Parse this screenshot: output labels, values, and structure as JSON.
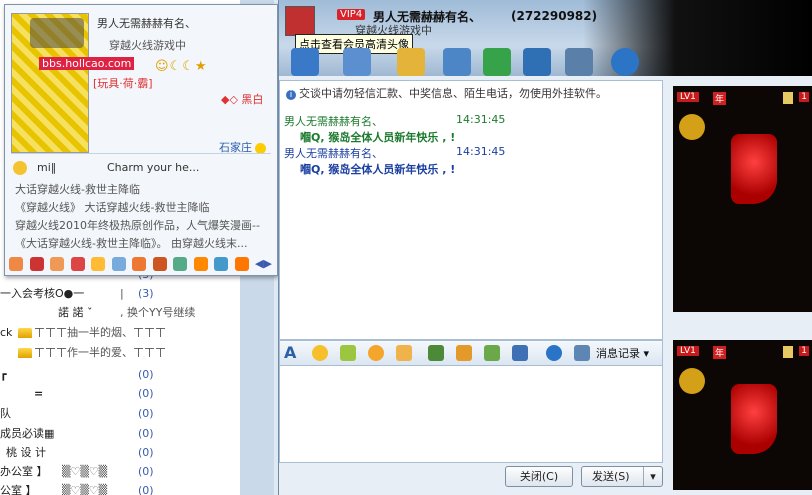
{
  "contacts": {
    "rows": [
      {
        "name": "",
        "extra": "",
        "count": "(3)"
      },
      {
        "name": "一入会考核O●一",
        "extra": "|",
        "count": "(3)"
      },
      {
        "name": "諾  諾  ˇ",
        "extra": ", 换个YY号继续",
        "count": ""
      },
      {
        "name": "ck",
        "extra": "ㄒㄒㄒ抽一半的烟、ㄒㄒㄒ",
        "count": ""
      },
      {
        "name": "",
        "extra": "ㄒㄒㄒ作一半的爱、ㄒㄒㄒ",
        "count": ""
      },
      {
        "name": "┏",
        "extra": "",
        "count": "(0)"
      },
      {
        "name": "=",
        "extra": "",
        "count": "(0)"
      },
      {
        "name": "队",
        "extra": "",
        "count": "(0)"
      },
      {
        "name": "成员必读▦",
        "extra": "",
        "count": "(0)"
      },
      {
        "name": "桃 设 计",
        "extra": "",
        "count": "(0)"
      },
      {
        "name": "办公室 】",
        "extra": "▒♡▒♡▒",
        "count": "(0)"
      },
      {
        "name": "公室 】",
        "extra": "▒♡▒♡▒",
        "count": "(0)"
      }
    ]
  },
  "card": {
    "name": "男人无需赫赫有名、",
    "status": "穿越火线游戏中",
    "site": "bbs.hollcao.com",
    "slogan": "[玩具·荷·霸]",
    "flags": "☺☾☾★",
    "color_note": "◆◇ 黑白",
    "city": "石家庄",
    "nick": "mi‖",
    "signature": "Charm your he...",
    "news": [
      "大话穿越火线-救世主降临",
      "《穿越火线》 大话穿越火线-救世主降临",
      "穿越火线2010年终极热原创作品，人气爆笑漫画--",
      "《大话穿越火线-救世主降临》。 由穿越火线末..."
    ]
  },
  "chat": {
    "vip": "VIP4",
    "name": "男人无需赫赫有名、",
    "qq": "(272290982)",
    "sub_status": "穿越火线游戏中",
    "tooltip": "点击查看会员高清头像",
    "notice": "交谈中请勿轻信汇款、中奖信息、陌生电话，勿使用外挂软件。",
    "messages": [
      {
        "sender": "男人无需赫赫有名、",
        "time": "14:31:45",
        "text": "嗰Q, 猴岛全体人员新年快乐 , !",
        "color": "#1c7a2e"
      },
      {
        "sender": "男人无需赫赫有名、",
        "time": "14:31:45",
        "text": "嗰Q, 猴岛全体人员新年快乐 , !",
        "color": "#1a3fa0"
      }
    ],
    "msg_log": "消息记录",
    "close_label": "关闭(C)",
    "send_label": "发送(S)"
  },
  "ads": [
    {
      "level": "LV1",
      "nian": "年",
      "count": "1"
    },
    {
      "level": "LV1",
      "nian": "年",
      "count": "1"
    }
  ]
}
